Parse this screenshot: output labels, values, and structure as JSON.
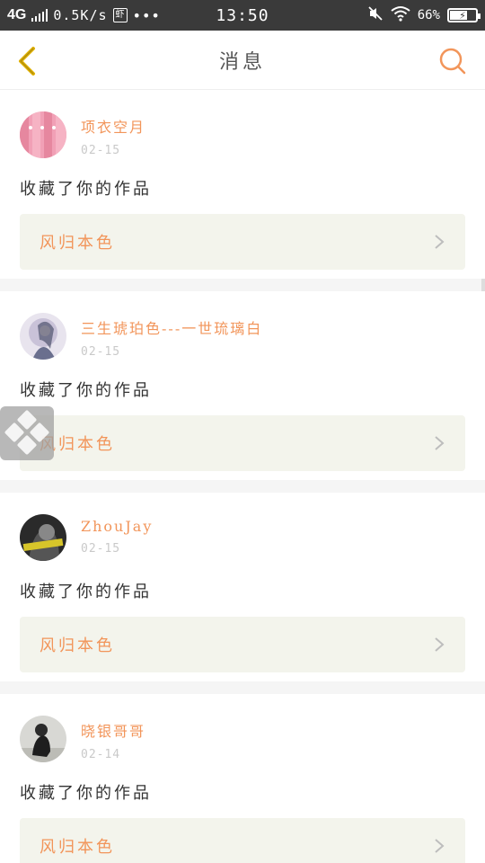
{
  "status_bar": {
    "network": "4G",
    "speed": "0.5K/s",
    "badge": "虾",
    "dots": "•••",
    "time": "13:50",
    "battery": "66%"
  },
  "nav": {
    "title": "消息"
  },
  "messages": [
    {
      "username": "项衣空月",
      "date": "02-15",
      "action": "收藏了你的作品",
      "work_title": "风归本色"
    },
    {
      "username": "三生琥珀色---一世琉璃白",
      "date": "02-15",
      "action": "收藏了你的作品",
      "work_title": "风归本色"
    },
    {
      "username": "ZhouJay",
      "date": "02-15",
      "action": "收藏了你的作品",
      "work_title": "风归本色"
    },
    {
      "username": "晓银哥哥",
      "date": "02-14",
      "action": "收藏了你的作品",
      "work_title": "风归本色"
    }
  ],
  "colors": {
    "accent": "#f2955a",
    "back_arrow": "#e0b000",
    "status_bar_bg": "#3a3a3a",
    "link_bg": "#f3f4ec"
  }
}
